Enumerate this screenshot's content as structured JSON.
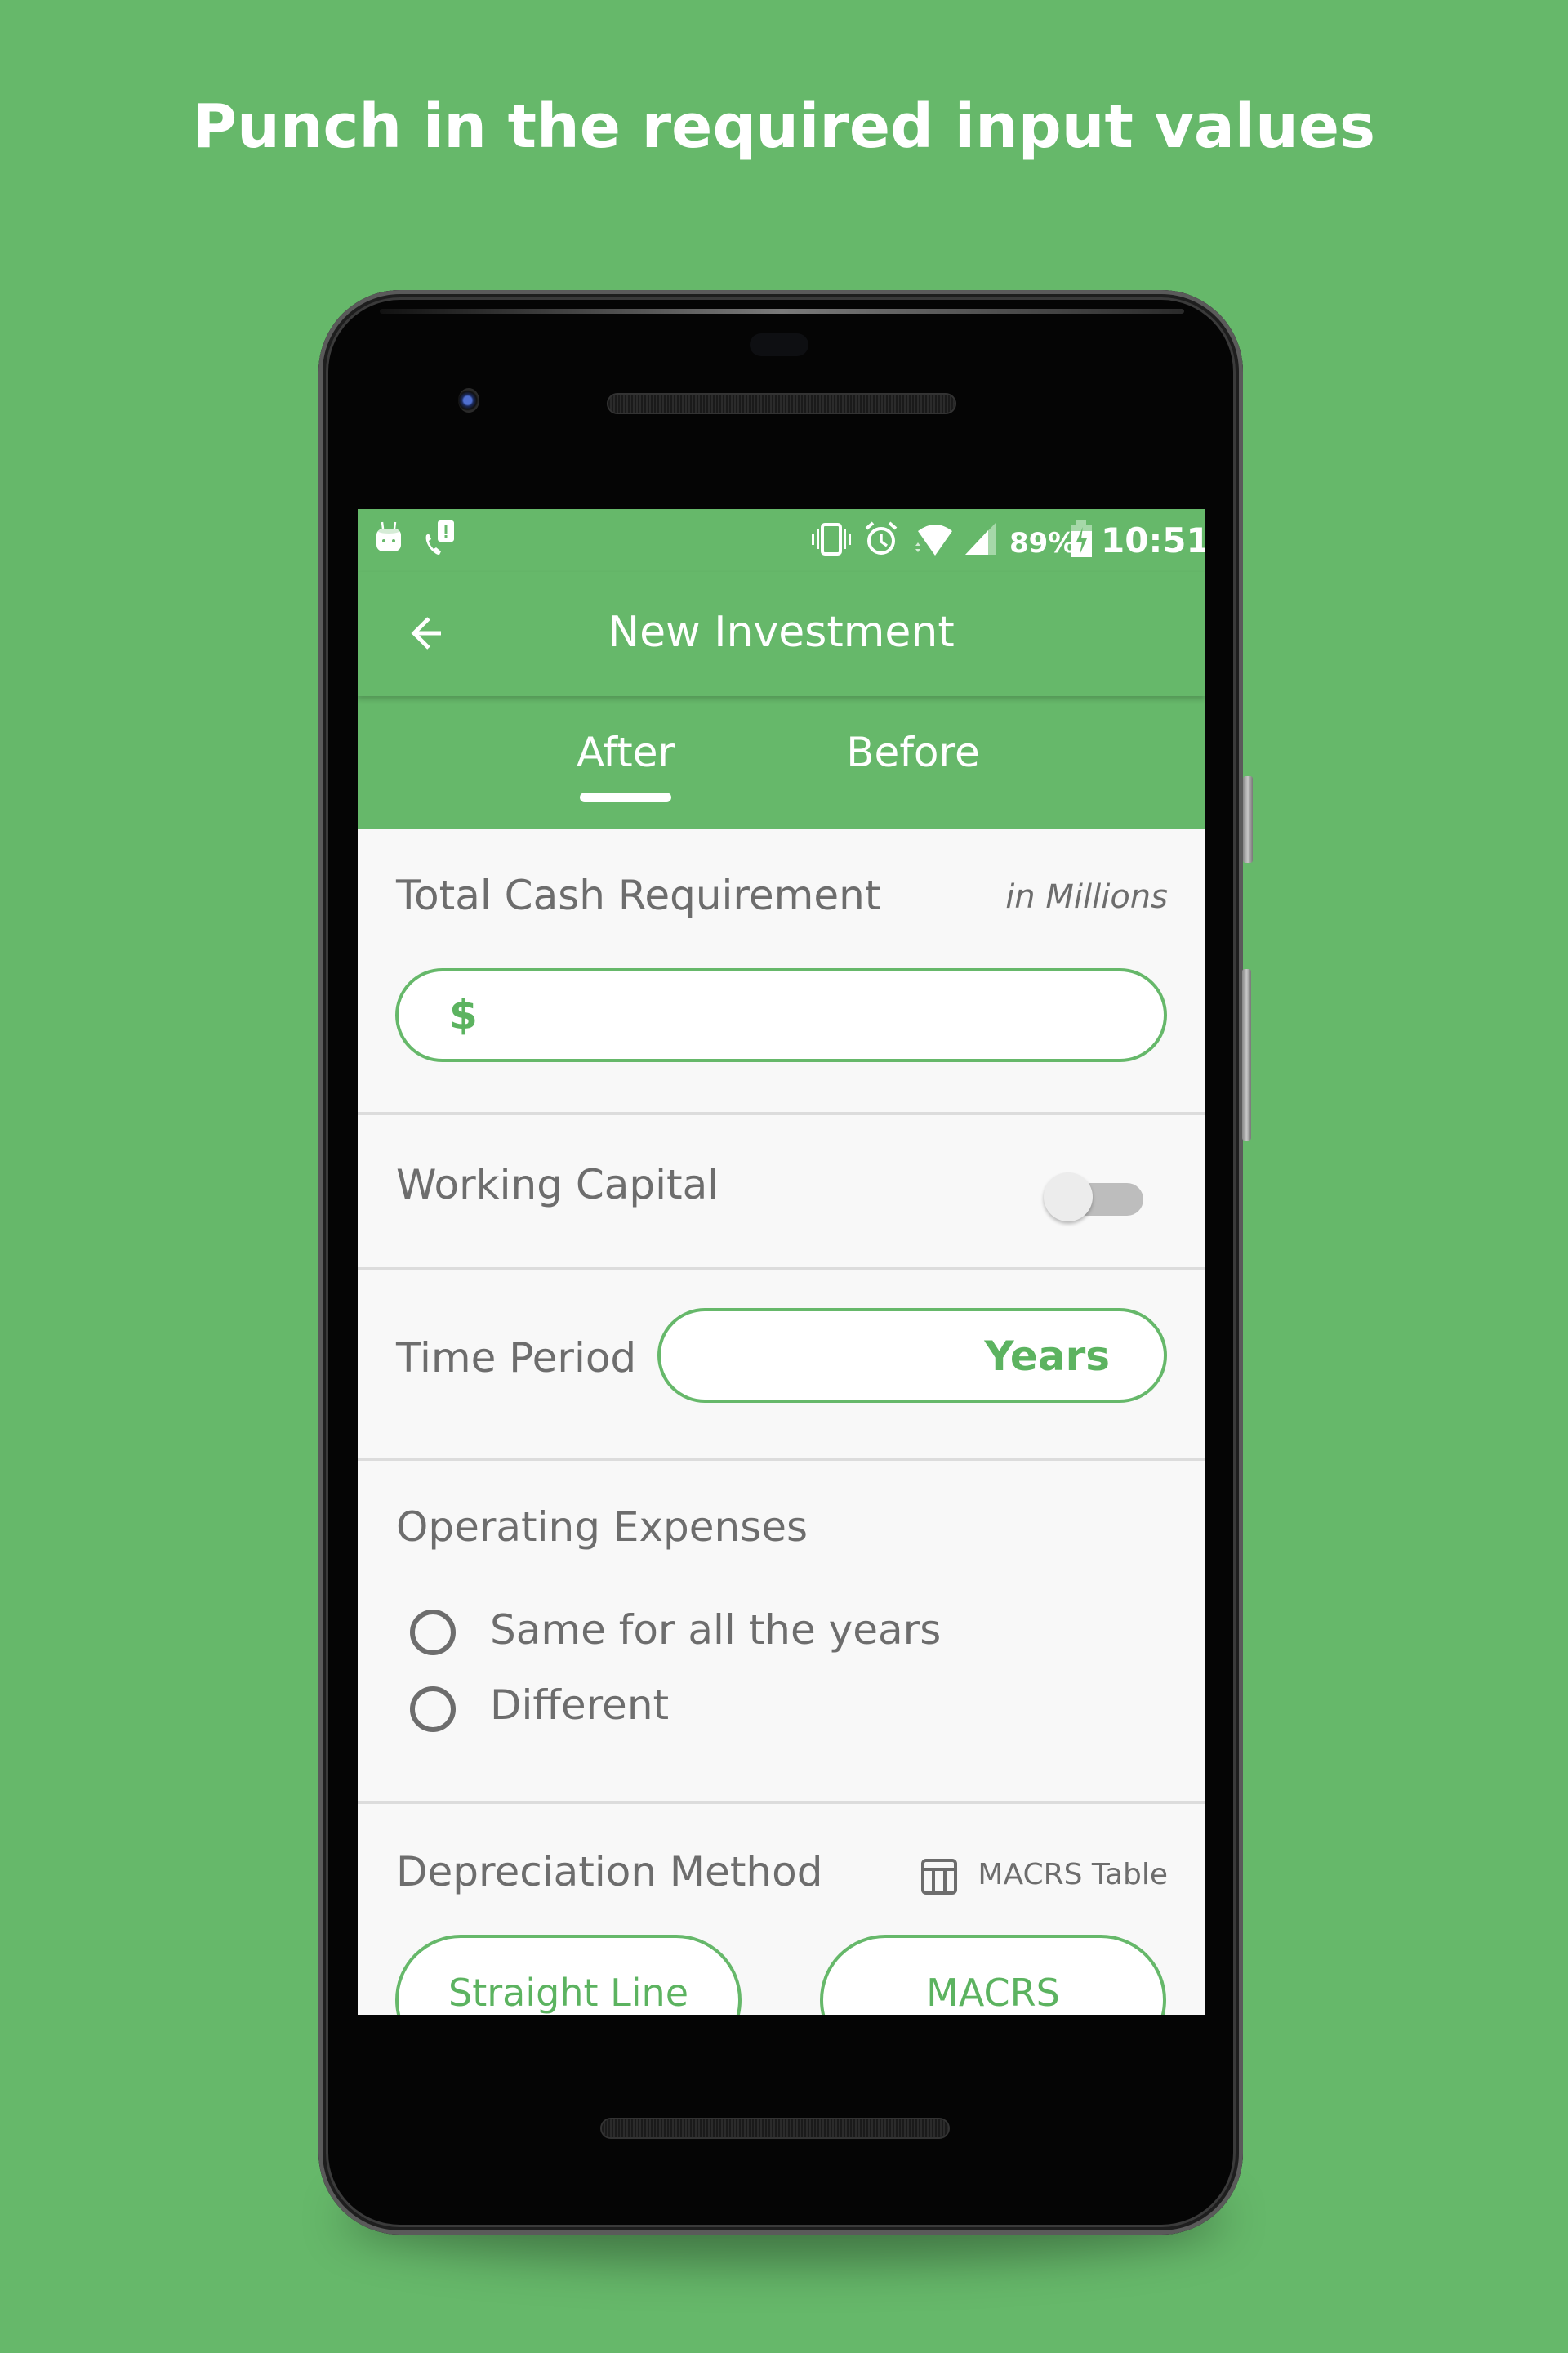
{
  "headline": "Punch in the required input values",
  "colors": {
    "brand_green": "#66b86a",
    "accent_text_green": "#5cb360",
    "label_gray": "#6d6d6d",
    "content_background": "#f8f8f8"
  },
  "status_bar": {
    "left_icons": [
      "android-notification-icon",
      "missed-call-icon"
    ],
    "right_icons": [
      "vibrate-icon",
      "alarm-icon",
      "wifi-icon",
      "cell-signal-icon"
    ],
    "battery_percent": "89%",
    "battery_icon": "battery-charging-icon",
    "time": "10:51"
  },
  "app_bar": {
    "back_icon": "arrow-left-icon",
    "title": "New Investment"
  },
  "tabs": [
    {
      "label": "After",
      "selected": true
    },
    {
      "label": "Before",
      "selected": false
    }
  ],
  "form": {
    "total_cash": {
      "label": "Total Cash Requirement",
      "unit_hint": "in Millions",
      "currency_symbol": "$",
      "value": ""
    },
    "working_capital": {
      "label": "Working Capital",
      "enabled": false
    },
    "time_period": {
      "label": "Time Period",
      "value": "",
      "suffix": "Years"
    },
    "operating_expenses": {
      "label": "Operating Expenses",
      "options": [
        {
          "label": "Same for all the years",
          "selected": false
        },
        {
          "label": "Different",
          "selected": false
        }
      ]
    },
    "depreciation_method": {
      "label": "Depreciation Method",
      "table_link_icon": "table-icon",
      "table_link_label": "MACRS Table",
      "options": [
        {
          "label": "Straight Line"
        },
        {
          "label": "MACRS"
        }
      ]
    }
  }
}
